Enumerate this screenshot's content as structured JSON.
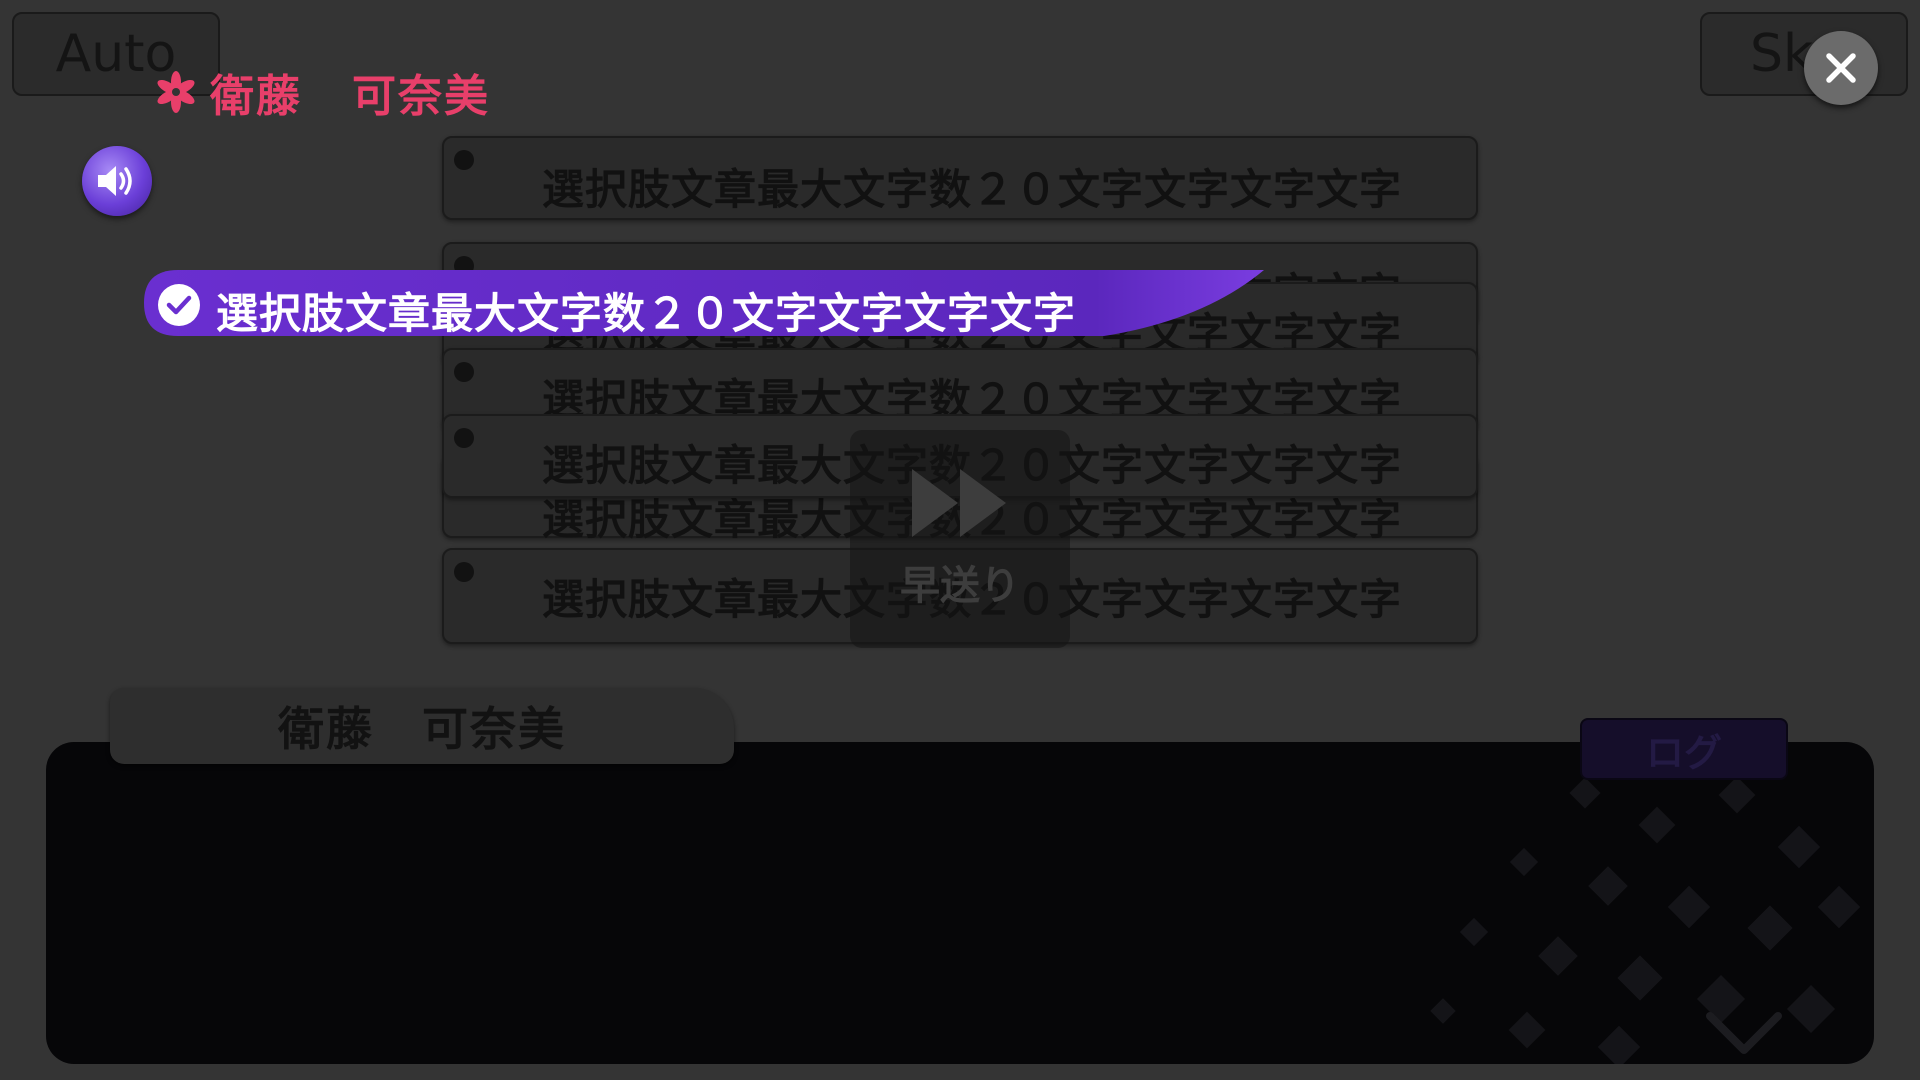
{
  "topbar": {
    "auto_label": "Auto",
    "skip_label": "Sk"
  },
  "history": {
    "speaker_first": "衛藤",
    "speaker_last": "可奈美",
    "speaker_color": "#e83f6a"
  },
  "choices": [
    {
      "text": "選択肢文章最大文字数２０文字文字文字文字"
    },
    {
      "text": "選択肢文章最大文字数２０文字文字文字文字"
    },
    {
      "text": "選択肢文章最大文字数２０文字文字文字文字"
    },
    {
      "text": "選択肢文章最大文字数２０文字文字文字文字"
    },
    {
      "text": "選択肢文章最大文字数２０文字文字文字文字"
    },
    {
      "text": "選択肢文章最大文字数２０文字文字文字文字"
    },
    {
      "text": "選択肢文章最大文字数２０文字文字文字文字"
    }
  ],
  "selected_choice": {
    "text": "選択肢文章最大文字数２０文字文字文字文字",
    "color": "#6a2fd0"
  },
  "fast_forward": {
    "label": "早送り"
  },
  "message": {
    "speaker_name": "衛藤　可奈美",
    "body": "",
    "log_label": "ログ"
  },
  "icons": {
    "close": "close-icon",
    "voice": "speaker-icon",
    "flower": "flower-icon",
    "check": "check-icon",
    "fast_forward": "fast-forward-icon",
    "next": "chevron-down-icon"
  }
}
